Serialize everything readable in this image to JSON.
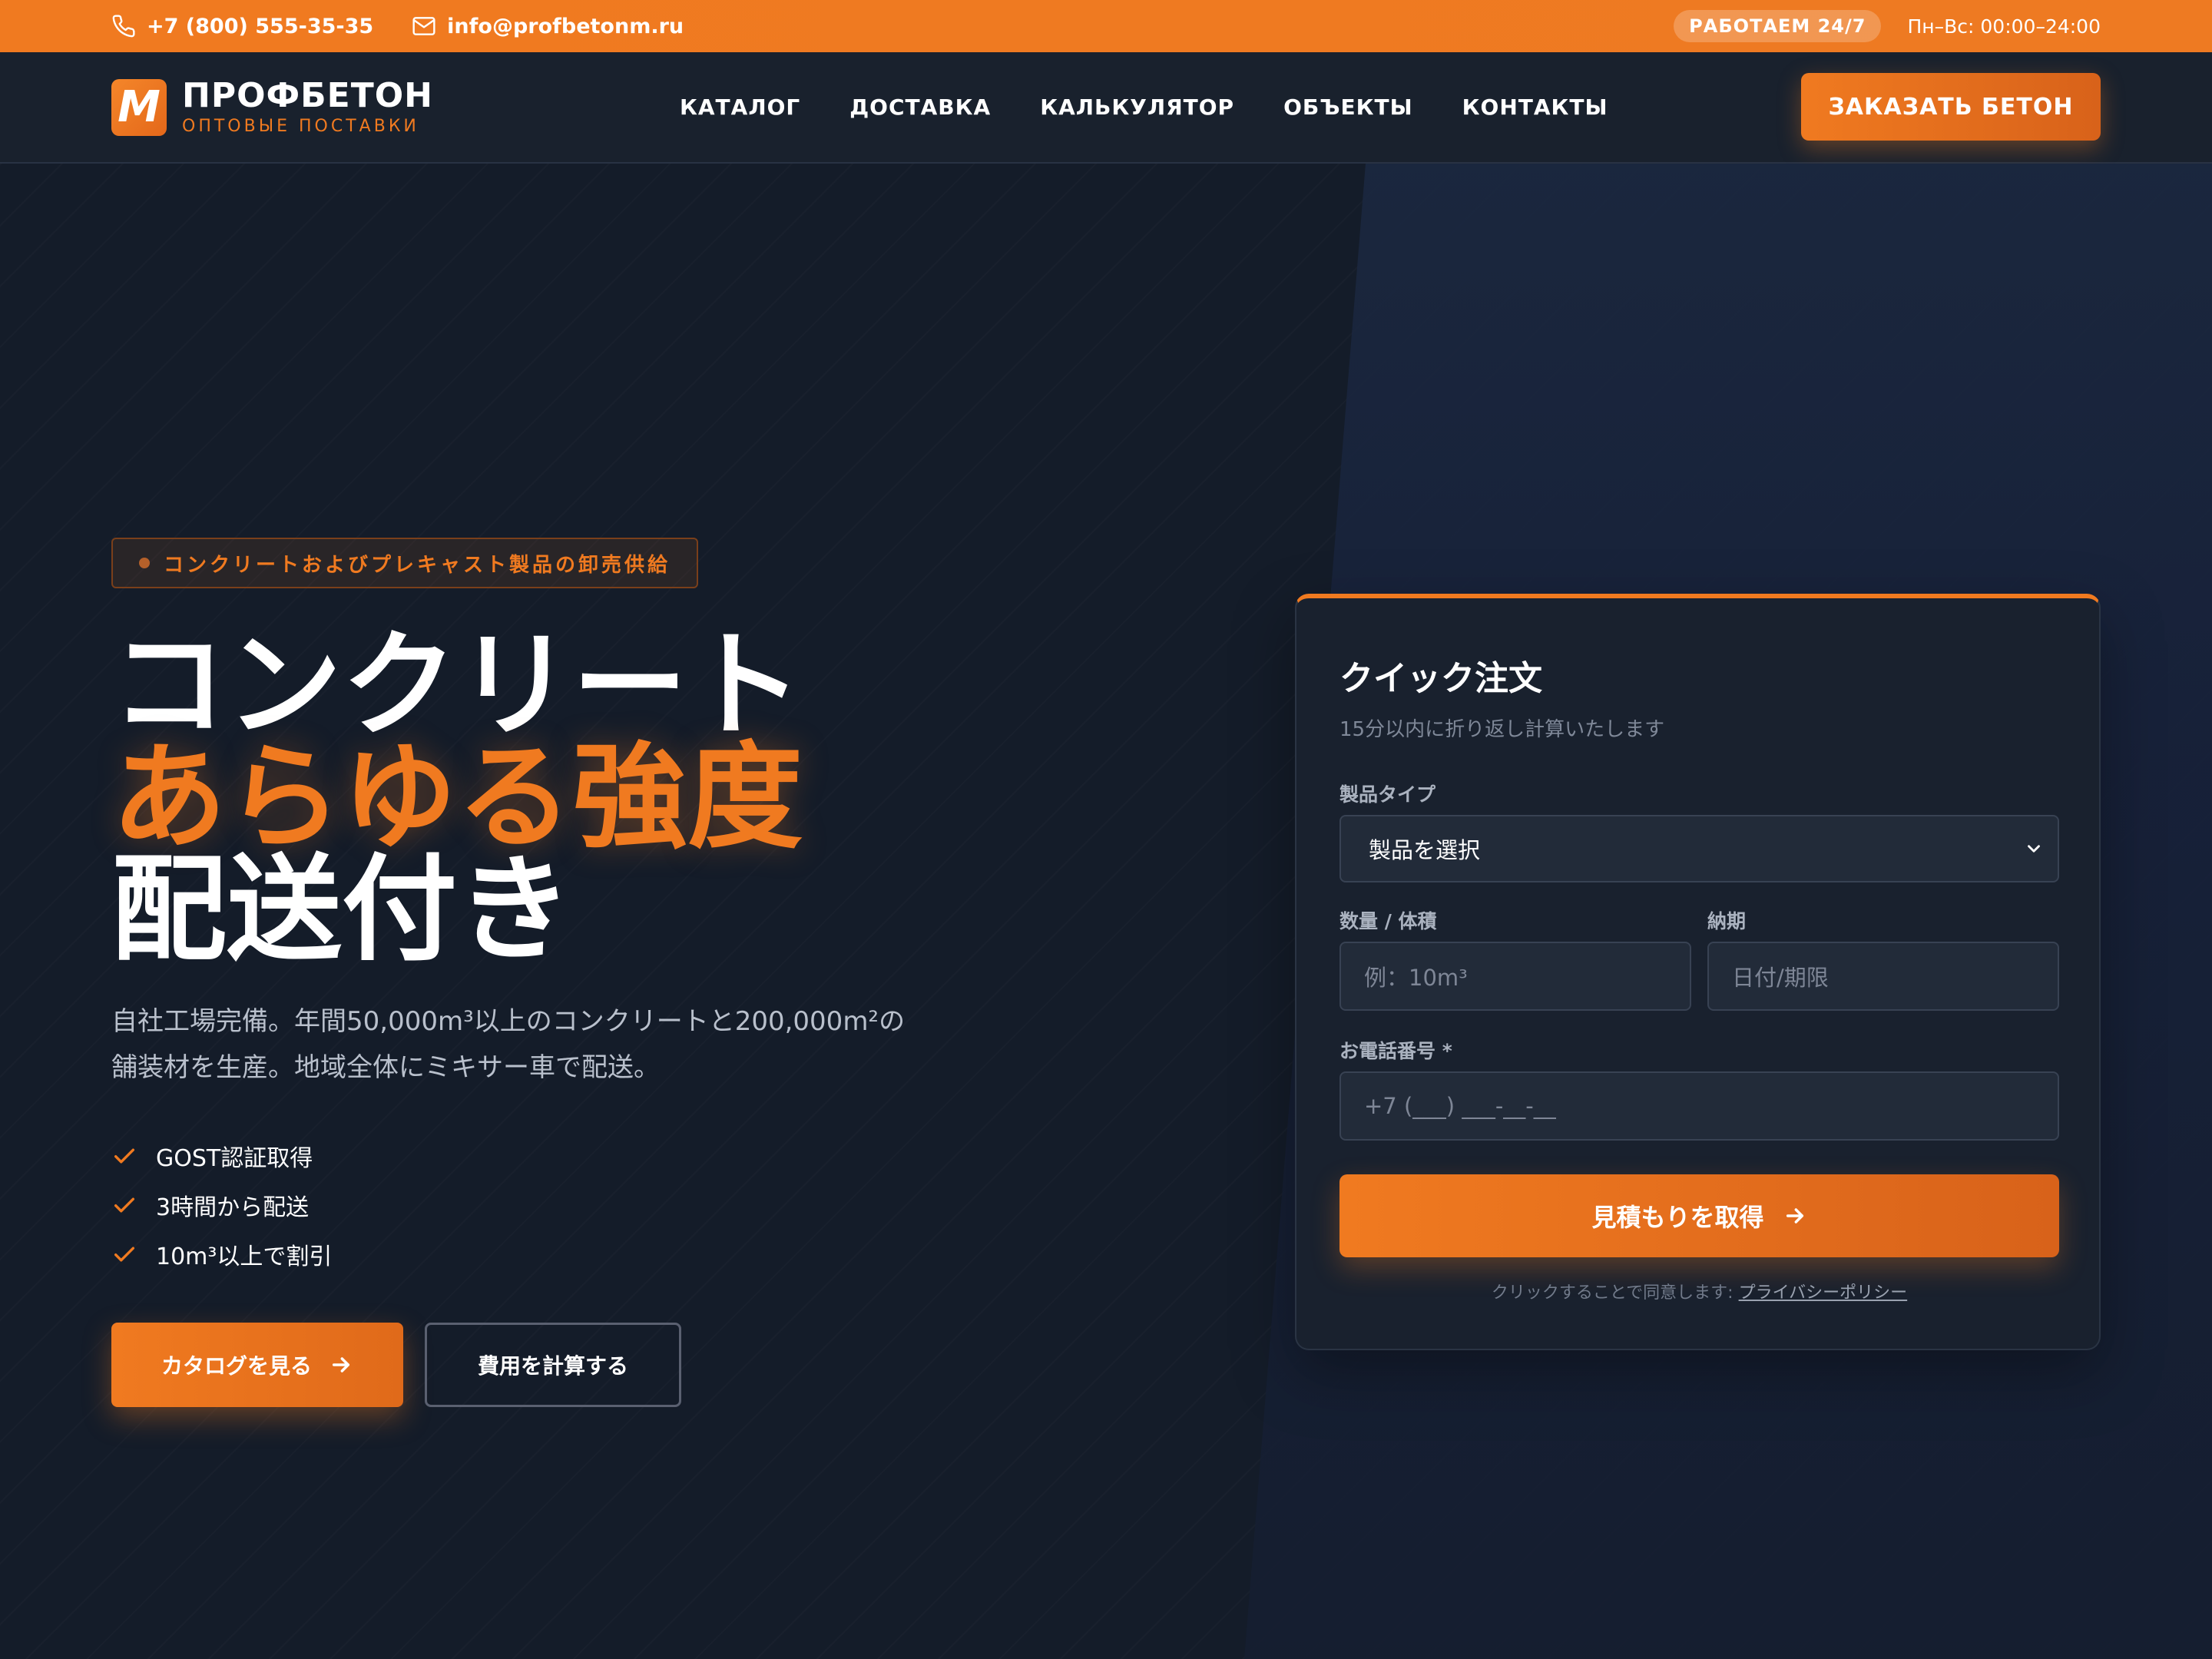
{
  "topbar": {
    "phone": "+7 (800) 555-35-35",
    "email": "info@profbetonm.ru",
    "badge": "РАБОТАЕМ 24/7",
    "hours": "Пн–Вс: 00:00–24:00"
  },
  "header": {
    "logo_mark": "M",
    "logo_name": "ПРОФБЕТОН",
    "logo_sub": "ОПТОВЫЕ ПОСТАВКИ",
    "nav": [
      "КАТАЛОГ",
      "ДОСТАВКА",
      "КАЛЬКУЛЯТОР",
      "ОБЪЕКТЫ",
      "КОНТАКТЫ"
    ],
    "order_button": "ЗАКАЗАТЬ БЕТОН"
  },
  "hero": {
    "tagline": "コンクリートおよびプレキャスト製品の卸売供給",
    "title_line1": "コンクリート",
    "title_line2": "あらゆる強度",
    "title_line3": "配送付き",
    "lead": "自社工場完備。年間50,000m³以上のコンクリートと200,000m²の舗装材を生産。地域全体にミキサー車で配送。",
    "features": [
      "GOST認証取得",
      "3時間から配送",
      "10m³以上で割引"
    ],
    "catalog_button": "カタログを見る",
    "calc_button": "費用を計算する"
  },
  "form": {
    "title": "クイック注文",
    "subtitle": "15分以内に折り返し計算いたします",
    "product_label": "製品タイプ",
    "product_value": "製品を選択",
    "quantity_label": "数量 / 体積",
    "quantity_placeholder": "例：10m³",
    "date_label": "納期",
    "date_placeholder": "日付/期限",
    "phone_label": "お電話番号 *",
    "phone_placeholder": "+7 (___) ___-__-__",
    "submit": "見積もりを取得",
    "consent_text": "クリックすることで同意します: ",
    "consent_link": "プライバシーポリシー"
  },
  "colors": {
    "accent": "#f07a20",
    "background": "#141c29",
    "header": "#19212d",
    "card": "#19212e"
  },
  "icons": {
    "phone": "phone-icon",
    "email": "mail-icon",
    "check": "check-icon",
    "arrow": "arrow-right-icon",
    "dropdown": "chevron-down-icon"
  }
}
